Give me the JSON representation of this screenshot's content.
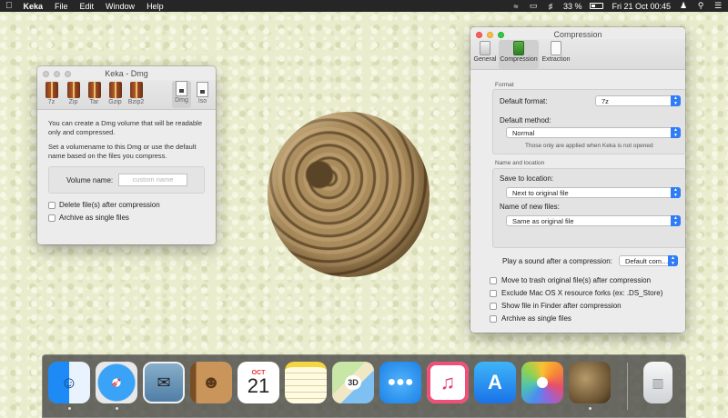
{
  "menubar": {
    "apple_icon": "apple-icon",
    "app_name": "Keka",
    "items": [
      "File",
      "Edit",
      "Window",
      "Help"
    ],
    "battery_percent": "33 %",
    "datetime": "Fri 21 Oct  00:45",
    "status_icons": [
      "wifi-icon",
      "airplay-icon",
      "volume-icon",
      "battery-icon",
      "user-icon",
      "spotlight-icon",
      "notification-center-icon"
    ]
  },
  "keka_window": {
    "title": "Keka - Dmg",
    "formats": [
      {
        "label": "7z"
      },
      {
        "label": "Zip"
      },
      {
        "label": "Tar"
      },
      {
        "label": "Gzip"
      },
      {
        "label": "Bzip2"
      },
      {
        "label": "Dmg"
      },
      {
        "label": "Iso"
      }
    ],
    "active_format": "Dmg",
    "description_1": "You can create a Dmg volume that will be readable only and compressed.",
    "description_2": "Set a volumename to this Dmg or use the default name based on the files you compress.",
    "volume_label": "Volume name:",
    "volume_placeholder": "custom name",
    "delete_files": "Delete file(s) after compression",
    "archive_single": "Archive as single files"
  },
  "compression_window": {
    "title": "Compression",
    "tabs": [
      {
        "label": "General"
      },
      {
        "label": "Compression"
      },
      {
        "label": "Extraction"
      }
    ],
    "active_tab": "Compression",
    "format_group": "Format",
    "default_format_label": "Default format:",
    "default_format_value": "7z",
    "default_method_label": "Default method:",
    "default_method_value": "Normal",
    "format_note": "Those only are applied when Keka is not opened",
    "location_group": "Name and location",
    "save_location_label": "Save to location:",
    "save_location_value": "Next to original file",
    "new_files_label": "Name of new files:",
    "new_files_value": "Same as original file",
    "sound_label": "Play a sound after a compression:",
    "sound_value": "Default com…",
    "options": [
      "Move to trash original file(s) after compression",
      "Exclude Mac OS X resource forks (ex: .DS_Store)",
      "Show file in Finder after compression",
      "Archive as single files"
    ]
  },
  "dock": {
    "apps": [
      {
        "name": "Finder",
        "icon": "finder-icon",
        "running": true
      },
      {
        "name": "Safari",
        "icon": "safari-icon",
        "running": true
      },
      {
        "name": "Mail",
        "icon": "mail-icon",
        "running": false
      },
      {
        "name": "Contacts",
        "icon": "contacts-icon",
        "running": false
      },
      {
        "name": "Calendar",
        "icon": "calendar-icon",
        "running": false,
        "month": "OCT",
        "day": "21"
      },
      {
        "name": "Notes",
        "icon": "notes-icon",
        "running": false
      },
      {
        "name": "Maps",
        "icon": "maps-icon",
        "running": false,
        "badge": "3D"
      },
      {
        "name": "Messages",
        "icon": "messages-icon",
        "running": false
      },
      {
        "name": "iTunes",
        "icon": "itunes-icon",
        "running": false
      },
      {
        "name": "App Store",
        "icon": "app-store-icon",
        "running": false
      },
      {
        "name": "Photos",
        "icon": "photos-icon",
        "running": false
      },
      {
        "name": "Keka",
        "icon": "keka-icon",
        "running": true
      },
      {
        "name": "Trash",
        "icon": "trash-icon",
        "running": false
      }
    ]
  }
}
